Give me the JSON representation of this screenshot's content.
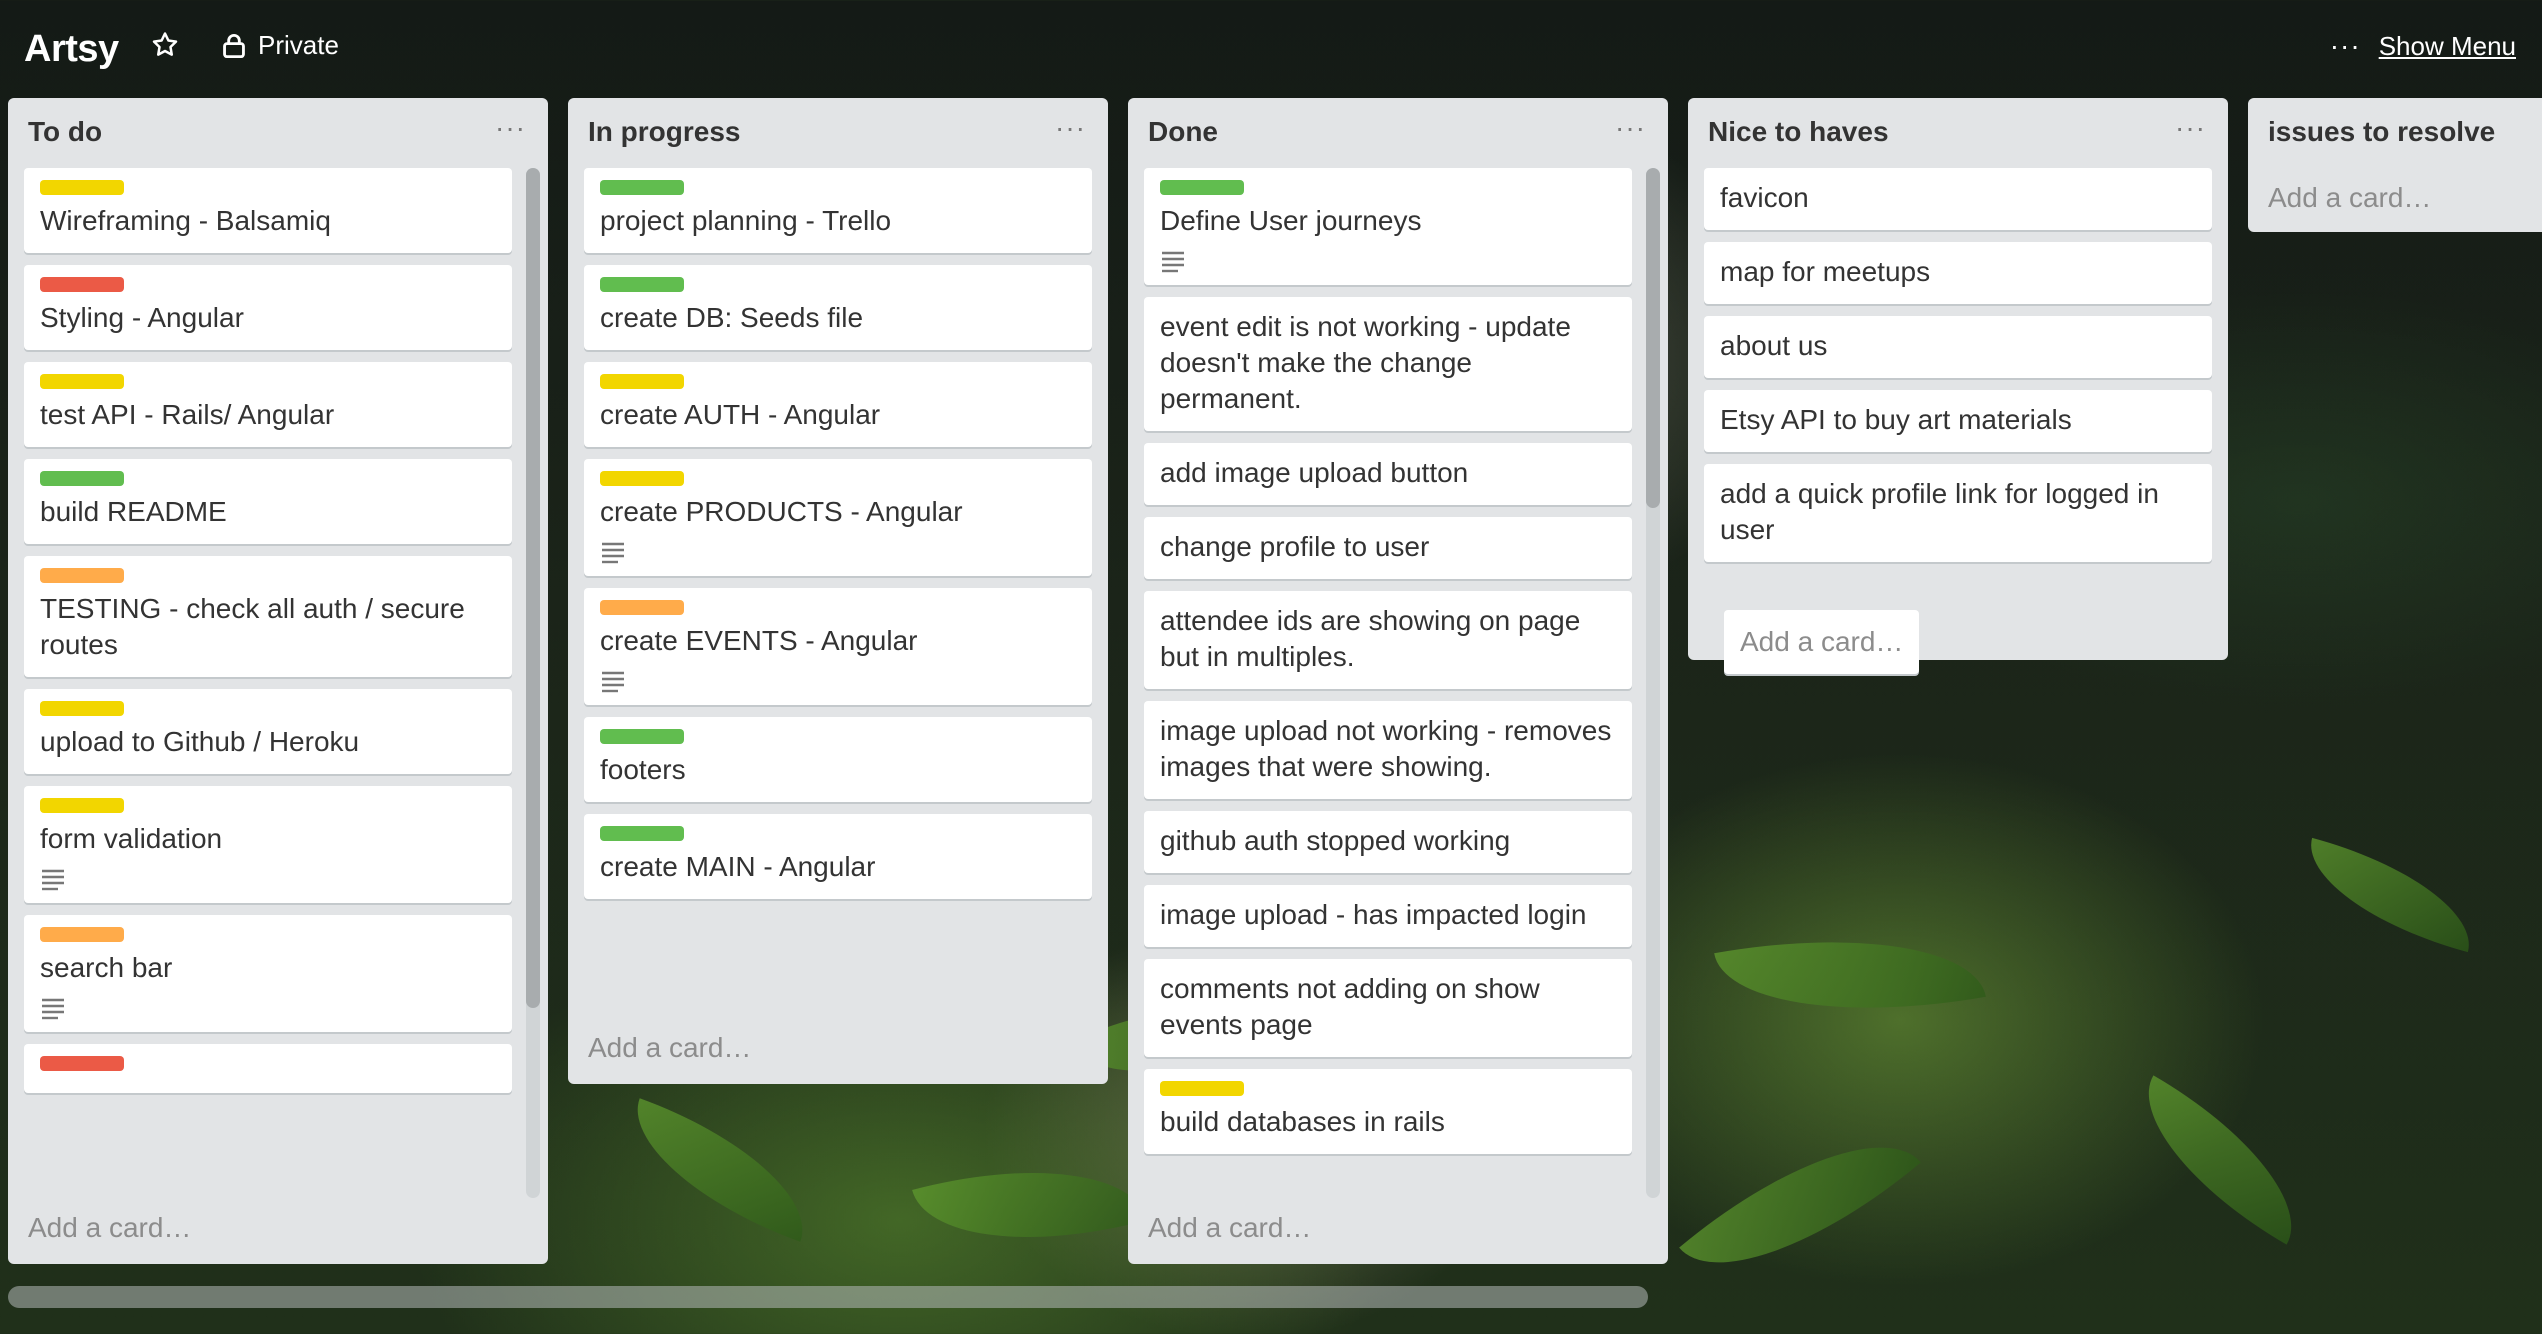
{
  "header": {
    "board_name": "Artsy",
    "privacy_label": "Private",
    "show_menu_label": "Show Menu"
  },
  "labels": {
    "yellow": "#f2d600",
    "red": "#eb5a46",
    "green": "#61bd4f",
    "orange": "#ffab4a"
  },
  "lists": [
    {
      "title": "To do",
      "add_card": "Add a card…",
      "cards": [
        {
          "text": "Wireframing - Balsamiq",
          "label": "yellow"
        },
        {
          "text": "Styling - Angular",
          "label": "red"
        },
        {
          "text": "test API - Rails/ Angular",
          "label": "yellow"
        },
        {
          "text": "build README",
          "label": "green"
        },
        {
          "text": "TESTING - check all auth / secure routes",
          "label": "orange"
        },
        {
          "text": "upload to Github / Heroku",
          "label": "yellow"
        },
        {
          "text": "form validation",
          "label": "yellow",
          "has_description": true
        },
        {
          "text": "search bar",
          "label": "orange",
          "has_description": true
        },
        {
          "text": "",
          "label": "red"
        }
      ]
    },
    {
      "title": "In progress",
      "add_card": "Add a card…",
      "cards": [
        {
          "text": "project planning - Trello",
          "label": "green"
        },
        {
          "text": "create DB: Seeds file",
          "label": "green"
        },
        {
          "text": "create AUTH - Angular",
          "label": "yellow"
        },
        {
          "text": "create PRODUCTS - Angular",
          "label": "yellow",
          "has_description": true
        },
        {
          "text": "create EVENTS - Angular",
          "label": "orange",
          "has_description": true
        },
        {
          "text": "footers",
          "label": "green"
        },
        {
          "text": "create MAIN - Angular",
          "label": "green"
        }
      ]
    },
    {
      "title": "Done",
      "add_card": "Add a card…",
      "cards": [
        {
          "text": "Define User journeys",
          "label": "green",
          "has_description": true
        },
        {
          "text": "event edit is not working - update doesn't make the change permanent."
        },
        {
          "text": "add image upload button"
        },
        {
          "text": "change profile to user"
        },
        {
          "text": "attendee ids are showing on page but in multiples."
        },
        {
          "text": "image upload not working - removes images that were showing."
        },
        {
          "text": "github auth stopped working"
        },
        {
          "text": "image upload - has impacted login"
        },
        {
          "text": "comments not adding on show events page"
        },
        {
          "text": "build databases in rails",
          "label": "yellow"
        }
      ]
    },
    {
      "title": "Nice to haves",
      "add_card": "Add a card…",
      "cards": [
        {
          "text": "favicon"
        },
        {
          "text": "map for meetups"
        },
        {
          "text": "about us"
        },
        {
          "text": "Etsy API to buy art materials"
        },
        {
          "text": "add a quick profile link for logged in user"
        }
      ]
    },
    {
      "title": "issues to resolve",
      "add_card": "Add a card…",
      "cards": []
    }
  ],
  "icons": {
    "star": "star-icon",
    "lock": "lock-icon",
    "list_menu": "ellipsis-icon",
    "description": "description-icon"
  }
}
